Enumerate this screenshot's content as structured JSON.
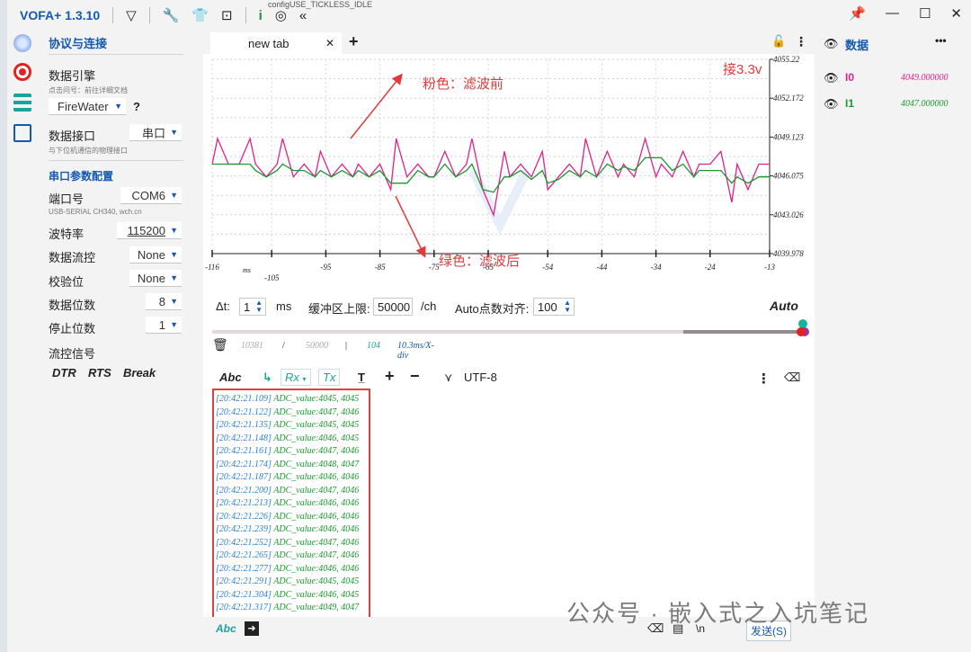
{
  "titlebar": {
    "app_title": "VOFA+ 1.3.10",
    "background_text": "configUSE_TICKLESS_IDLE"
  },
  "left_panel": {
    "protocol_title": "协议与连接",
    "engine_label": "数据引擎",
    "engine_hint": "点击问号：前往详细文档",
    "engine_value": "FireWater",
    "help_glyph": "?",
    "interface_label": "数据接口",
    "interface_value": "串口",
    "interface_hint": "与下位机通信的物理接口",
    "serial_title": "串口参数配置",
    "port_label": "端口号",
    "port_value": "COM6",
    "port_hint": "USB-SERIAL CH340, wch.cn",
    "baud_label": "波特率",
    "baud_value": "115200",
    "flow_label": "数据流控",
    "flow_value": "None",
    "parity_label": "校验位",
    "parity_value": "None",
    "databits_label": "数据位数",
    "databits_value": "8",
    "stopbits_label": "停止位数",
    "stopbits_value": "1",
    "flowsig_label": "流控信号",
    "flowsig_buttons": [
      "DTR",
      "RTS",
      "Break"
    ]
  },
  "center": {
    "tab_label": "new tab",
    "annotations": {
      "supply": "接3.3v",
      "pink": "粉色：滤波前",
      "green": "绿色：滤波后"
    },
    "controls": {
      "dt_label": "Δt:",
      "dt_value": "1",
      "dt_unit": "ms",
      "buffer_label": "缓冲区上限:",
      "buffer_value": "50000",
      "buffer_unit": "/ch",
      "auto_label": "Auto点数对齐:",
      "auto_value": "100",
      "auto_mode": "Auto"
    },
    "stats": {
      "count": "10381",
      "slash": "/",
      "limit": "50000",
      "bar": "|",
      "points": "104",
      "scale": "10.3ms/X-div"
    },
    "toolbar": {
      "abc": "Abc",
      "rx": "Rx",
      "tx": "Tx",
      "plus": "+",
      "minus": "−",
      "encoding": "UTF-8"
    },
    "log_lines": [
      {
        "ts": "[20:42:21.109]",
        "msg": "ADC_value:4045, 4045"
      },
      {
        "ts": "[20:42:21.122]",
        "msg": "ADC_value:4047, 4046"
      },
      {
        "ts": "[20:42:21.135]",
        "msg": "ADC_value:4045, 4045"
      },
      {
        "ts": "[20:42:21.148]",
        "msg": "ADC_value:4046, 4045"
      },
      {
        "ts": "[20:42:21.161]",
        "msg": "ADC_value:4047, 4046"
      },
      {
        "ts": "[20:42:21.174]",
        "msg": "ADC_value:4048, 4047"
      },
      {
        "ts": "[20:42:21.187]",
        "msg": "ADC_value:4046, 4046"
      },
      {
        "ts": "[20:42:21.200]",
        "msg": "ADC_value:4047, 4046"
      },
      {
        "ts": "[20:42:21.213]",
        "msg": "ADC_value:4046, 4046"
      },
      {
        "ts": "[20:42:21.226]",
        "msg": "ADC_value:4046, 4046"
      },
      {
        "ts": "[20:42:21.239]",
        "msg": "ADC_value:4046, 4046"
      },
      {
        "ts": "[20:42:21.252]",
        "msg": "ADC_value:4047, 4046"
      },
      {
        "ts": "[20:42:21.265]",
        "msg": "ADC_value:4047, 4046"
      },
      {
        "ts": "[20:42:21.277]",
        "msg": "ADC_value:4046, 4046"
      },
      {
        "ts": "[20:42:21.291]",
        "msg": "ADC_value:4045, 4045"
      },
      {
        "ts": "[20:42:21.304]",
        "msg": "ADC_value:4046, 4045"
      },
      {
        "ts": "[20:42:21.317]",
        "msg": "ADC_value:4049, 4047"
      }
    ],
    "bottom": {
      "abc": "Abc",
      "newline": "\\n",
      "send": "发送(S)"
    }
  },
  "right_panel": {
    "title": "数据",
    "more": "•••",
    "channels": [
      {
        "name": "I0",
        "value": "4049.000000",
        "color": "#e0208a"
      },
      {
        "name": "I1",
        "value": "4047.000000",
        "color": "#1a9a2e"
      }
    ]
  },
  "watermark": "公众号 · 嵌入式之入坑笔记",
  "chart_data": {
    "type": "line",
    "x_tick_labels": [
      "-116",
      "-105",
      "-95",
      "-85",
      "-75",
      "-65",
      "-54",
      "-44",
      "-34",
      "-24",
      "-13"
    ],
    "x_unit": "ms",
    "y_tick_labels": [
      "4055.22",
      "4052.172",
      "4049.123",
      "4046.075",
      "4043.026",
      "4039.978"
    ],
    "ylim": [
      4039.978,
      4055.22
    ],
    "xlim": [
      -116,
      -13
    ],
    "grid": true,
    "series": [
      {
        "name": "I0",
        "color": "#e0208a",
        "x": [
          -116,
          -115,
          -113,
          -111,
          -109,
          -108,
          -106,
          -104,
          -103,
          -101,
          -99,
          -97,
          -96,
          -94,
          -92,
          -90,
          -89,
          -87,
          -85,
          -83,
          -82,
          -80,
          -78,
          -76,
          -75,
          -73,
          -71,
          -69,
          -68,
          -66,
          -64,
          -62,
          -61,
          -59,
          -57,
          -55,
          -54,
          -52,
          -50,
          -48,
          -47,
          -45,
          -43,
          -41,
          -40,
          -38,
          -36,
          -34,
          -33,
          -31,
          -29,
          -27,
          -26,
          -24,
          -22,
          -20,
          -19,
          -17,
          -15,
          -13
        ],
        "y": [
          4047,
          4049,
          4047,
          4047,
          4049,
          4047,
          4046,
          4047,
          4049,
          4046,
          4047,
          4046,
          4048,
          4046,
          4047,
          4046,
          4047,
          4046,
          4047,
          4045,
          4049,
          4046,
          4047,
          4046,
          4046,
          4048,
          4046,
          4047,
          4049,
          4045,
          4043,
          4048,
          4046,
          4047,
          4046,
          4048,
          4045,
          4046,
          4047,
          4046,
          4049,
          4046,
          4048,
          4046,
          4047,
          4046,
          4049,
          4046,
          4047,
          4046,
          4048,
          4046,
          4047,
          4047,
          4048,
          4044,
          4047,
          4045,
          4047,
          4047
        ]
      },
      {
        "name": "I1",
        "color": "#1a9a2e",
        "x": [
          -116,
          -115,
          -113,
          -111,
          -109,
          -108,
          -106,
          -104,
          -103,
          -101,
          -99,
          -97,
          -96,
          -94,
          -92,
          -90,
          -89,
          -87,
          -85,
          -83,
          -82,
          -80,
          -78,
          -76,
          -75,
          -73,
          -71,
          -69,
          -68,
          -66,
          -64,
          -62,
          -61,
          -59,
          -57,
          -55,
          -54,
          -52,
          -50,
          -48,
          -47,
          -45,
          -43,
          -41,
          -40,
          -38,
          -36,
          -34,
          -33,
          -31,
          -29,
          -27,
          -26,
          -24,
          -22,
          -20,
          -19,
          -17,
          -15,
          -13
        ],
        "y": [
          4047,
          4047,
          4047,
          4047,
          4047,
          4046.5,
          4046,
          4046.5,
          4047,
          4046.5,
          4046.5,
          4046,
          4046.5,
          4046,
          4046.5,
          4046,
          4046.5,
          4046,
          4046.5,
          4045.5,
          4045.5,
          4045.5,
          4046.5,
          4046,
          4046,
          4047,
          4046,
          4046.5,
          4047,
          4045,
          4044.8,
          4046,
          4046,
          4046.5,
          4045.8,
          4046.5,
          4045.5,
          4045.8,
          4046.5,
          4046,
          4046.5,
          4046,
          4047,
          4046.5,
          4046.8,
          4046.5,
          4047.5,
          4047.5,
          4047.5,
          4046.5,
          4047,
          4046,
          4046.5,
          4046.5,
          4046.5,
          4045.5,
          4046,
          4045.5,
          4046,
          4046
        ]
      }
    ]
  }
}
